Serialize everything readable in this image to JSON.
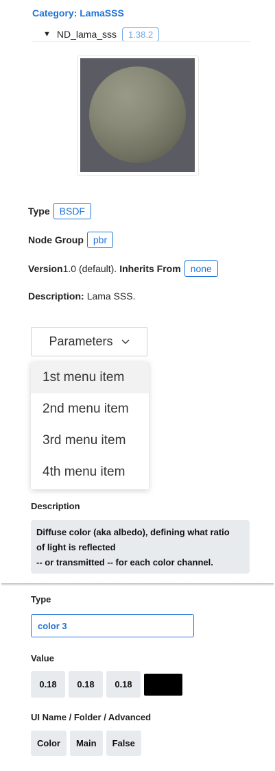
{
  "header": {
    "category": "Category: LamaSSS",
    "node_name": "ND_lama_sss",
    "version_badge": "1.38.2",
    "expand_glyph": "▼"
  },
  "info": {
    "type_label": "Type",
    "type_value": "BSDF",
    "node_group_label": "Node Group",
    "node_group_value": "pbr",
    "version_label": "Version",
    "version_value": "1.0 (default).",
    "inherits_label": "Inherits From",
    "inherits_value": "none",
    "description_label": "Description:",
    "description_value": "Lama SSS."
  },
  "parameters": {
    "button_label": "Parameters",
    "menu_items": [
      "1st menu item",
      "2nd menu item",
      "3rd menu item",
      "4th menu item"
    ]
  },
  "detail": {
    "description_title": "Description",
    "description_lines": [
      "Diffuse color (aka albedo), defining what ratio",
      "of light is reflected",
      "-- or transmitted -- for each color channel."
    ],
    "type_title": "Type",
    "type_value": "color 3",
    "value_title": "Value",
    "values": [
      "0.18",
      "0.18",
      "0.18"
    ],
    "swatch_color": "#000000",
    "ui_title": "UI Name / Folder / Advanced",
    "ui_values": [
      "Color",
      "Main",
      "False"
    ]
  },
  "colors": {
    "accent": "#1e73d9",
    "chip_bg": "#e8ebee"
  },
  "icons": {
    "expand": "triangle-down-icon",
    "dropdown": "chevron-down-icon"
  }
}
